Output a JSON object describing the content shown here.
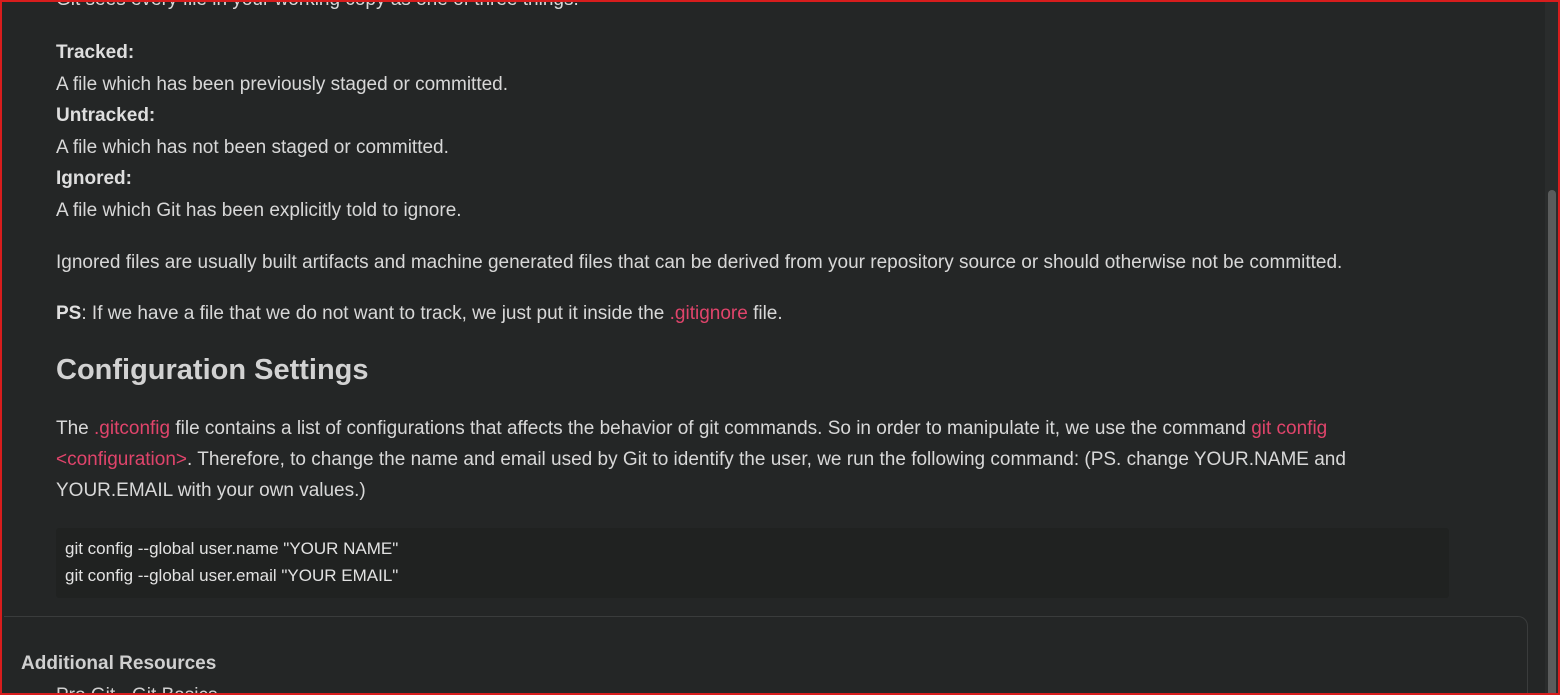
{
  "intro_cut": "Git sees every file in your working copy as one of three things:",
  "definitions": [
    {
      "term": "Tracked:",
      "desc": "A file which has been previously staged or committed."
    },
    {
      "term": "Untracked:",
      "desc": "A file which has not been staged or committed."
    },
    {
      "term": "Ignored:",
      "desc": "A file which Git has been explicitly told to ignore."
    }
  ],
  "ignored_note": "Ignored files are usually built artifacts and machine generated files that can be derived from your repository source or should otherwise not be committed.",
  "ps": {
    "label": "PS",
    "before": ": If we have a file that we do not want to track, we just put it inside the ",
    "code": ".gitignore",
    "after": " file."
  },
  "config_heading": "Configuration Settings",
  "config_para": {
    "p1": "The ",
    "code1": ".gitconfig",
    "p2": " file contains a list of configurations that affects the behavior of git commands. So in order to manipulate it, we use the command ",
    "code2": "git config <configuration>",
    "p3": ". Therefore, to change the name and email used by Git to identify the user, we run the following command: (PS. change YOUR.NAME and YOUR.EMAIL with your own values.)"
  },
  "code_block": [
    "git config --global user.name \"YOUR NAME\"",
    "git config --global user.email \"YOUR EMAIL\""
  ],
  "additional_resources": {
    "title": "Additional Resources",
    "first_item_peek": "Pro Git - Git Basics"
  }
}
